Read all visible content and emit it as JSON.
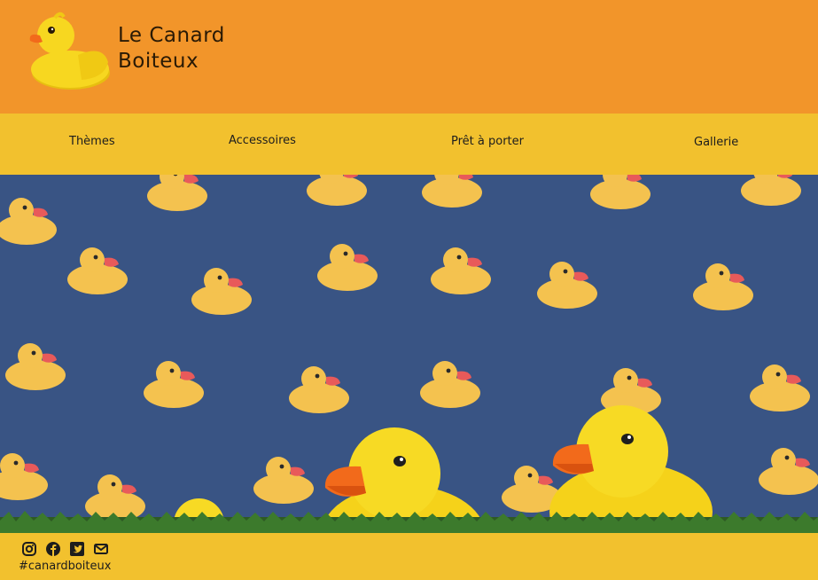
{
  "brand": {
    "line1": "Le Canard",
    "line2": "Boiteux"
  },
  "nav": {
    "items": [
      {
        "label": "Thèmes"
      },
      {
        "label": "Accessoires"
      },
      {
        "label": "Prêt à porter"
      },
      {
        "label": "Gallerie"
      }
    ]
  },
  "footer": {
    "social_icons": [
      "instagram-icon",
      "facebook-icon",
      "twitter-icon",
      "email-icon"
    ],
    "hashtag": "#canardboiteux"
  },
  "colors": {
    "header_bg": "#f2952a",
    "nav_bg": "#f2c12e",
    "footer_bg": "#f2c12e",
    "duck_yellow": "#f7d720",
    "beak_orange": "#f26a1b",
    "hero_bg": "#3d5889"
  }
}
